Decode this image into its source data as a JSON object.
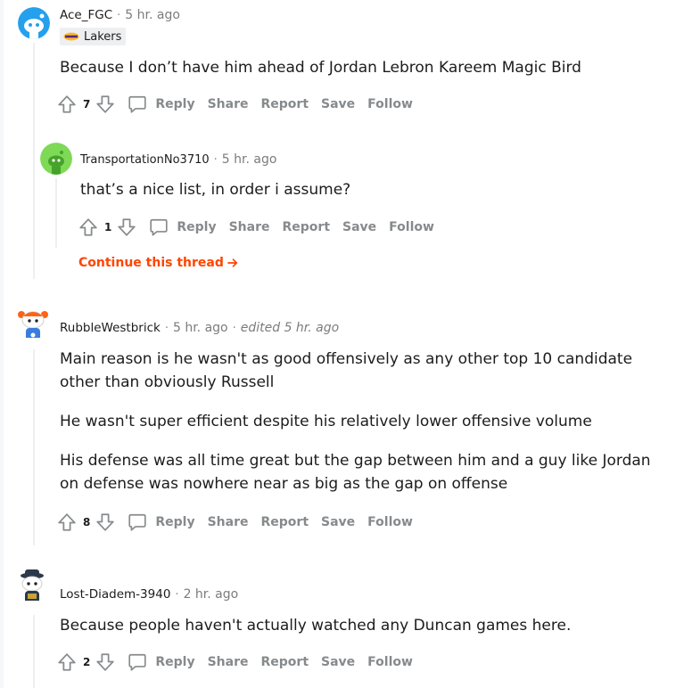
{
  "comments": [
    {
      "author": "Ace_FGC",
      "time": "5 hr. ago",
      "flair": "Lakers",
      "body": [
        "Because I don’t have him ahead of Jordan Lebron Kareem Magic Bird"
      ],
      "score": "7",
      "avatar_color": "#24a0ed",
      "replies": [
        {
          "author": "TransportationNo3710",
          "time": "5 hr. ago",
          "body": [
            "that’s a nice list, in order i assume?"
          ],
          "score": "1",
          "avatar_color": "#7ed957"
        }
      ],
      "continue_label": "Continue this thread"
    },
    {
      "author": "RubbleWestbrick",
      "time": "5 hr. ago",
      "edited": "edited 5 hr. ago",
      "body": [
        "Main reason is he wasn't as good offensively as any other top 10 candidate other than obviously Russell",
        "He wasn't super efficient despite his relatively lower offensive volume",
        "His defense was all time great but the gap between him and a guy like Jordan on defense was nowhere near as big as the gap on offense"
      ],
      "score": "8",
      "avatar_color": "#ff6314"
    },
    {
      "author": "Lost-Diadem-3940",
      "time": "2 hr. ago",
      "body": [
        "Because people haven't actually watched any Duncan games here."
      ],
      "score": "2",
      "avatar_color": "#2b3a4a"
    }
  ],
  "actions": {
    "reply": "Reply",
    "share": "Share",
    "report": "Report",
    "save": "Save",
    "follow": "Follow"
  },
  "separator": "·",
  "colors": {
    "accent": "#ff4500",
    "muted": "#878a8c",
    "thread_line": "#edeff1"
  }
}
